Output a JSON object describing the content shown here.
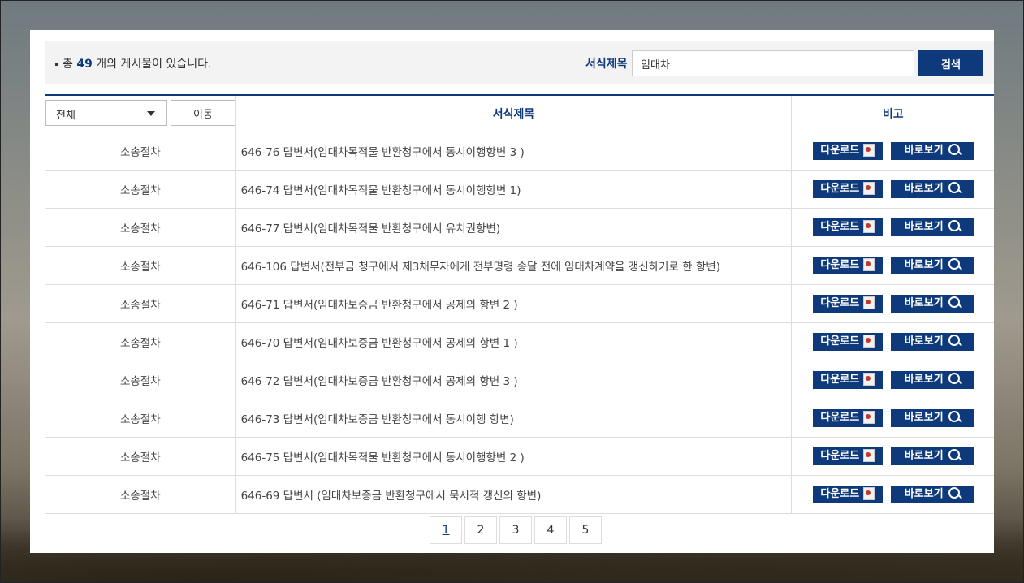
{
  "summary": {
    "prefix": "총",
    "count": "49",
    "suffix": "개의 게시물이 있습니다."
  },
  "search": {
    "label": "서식제목",
    "value": "임대차",
    "button": "검색"
  },
  "filter": {
    "selected": "전체",
    "move_button": "이동"
  },
  "table": {
    "headers": {
      "title": "서식제목",
      "note": "비고"
    },
    "download_label": "다운로드",
    "view_label": "바로보기",
    "rows": [
      {
        "category": "소송절차",
        "title": "646-76 답변서(임대차목적물 반환청구에서 동시이행항변 3 )"
      },
      {
        "category": "소송절차",
        "title": "646-74 답변서(임대차목적물 반환청구에서 동시이행항변 1)"
      },
      {
        "category": "소송절차",
        "title": "646-77 답변서(임대차목적물 반환청구에서 유치권항변)"
      },
      {
        "category": "소송절차",
        "title": "646-106 답변서(전부금 청구에서 제3채무자에게 전부명령 송달 전에 임대차계약을 갱신하기로 한 항변)"
      },
      {
        "category": "소송절차",
        "title": "646-71 답변서(임대차보증금 반환청구에서 공제의 항변 2 )"
      },
      {
        "category": "소송절차",
        "title": "646-70 답변서(임대차보증금 반환청구에서 공제의 항변 1 )"
      },
      {
        "category": "소송절차",
        "title": "646-72 답변서(임대차보증금 반환청구에서 공제의 항변 3 )"
      },
      {
        "category": "소송절차",
        "title": "646-73 답변서(임대차보증금 반환청구에서 동시이행 항변)"
      },
      {
        "category": "소송절차",
        "title": "646-75 답변서(임대차목적물 반환청구에서 동시이행항변 2 )"
      },
      {
        "category": "소송절차",
        "title": "646-69 답변서 (임대차보증금 반환청구에서 묵시적 갱신의 항변)"
      }
    ]
  },
  "pagination": {
    "pages": [
      "1",
      "2",
      "3",
      "4",
      "5"
    ],
    "current": "1"
  },
  "colors": {
    "accent": "#0e3a7c",
    "border": "#dddddd",
    "bar_bg": "#f3f3f3"
  },
  "icons": {
    "download": "document-icon",
    "view": "magnifier-icon",
    "select": "chevron-down-icon"
  }
}
